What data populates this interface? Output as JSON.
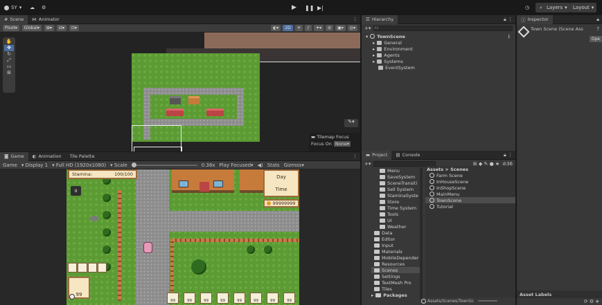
{
  "toolbar": {
    "account": "SY",
    "layers": "Layers",
    "layout": "Layout"
  },
  "scene_panel": {
    "tabs": [
      "Scene",
      "Animator"
    ],
    "pivot": "Pivot",
    "global": "Global",
    "mode_2d": "2D",
    "tilemap_focus": "Tilemap Focus",
    "focus_on_label": "Focus On",
    "focus_on_value": "None"
  },
  "game_panel": {
    "tabs": [
      "Game",
      "Animation",
      "Tile Palette"
    ],
    "display_label": "Game",
    "display": "Display 1",
    "resolution": "Full HD (1920x1080)",
    "scale_label": "Scale",
    "scale_value": "0.38x",
    "play_focused": "Play Focused",
    "stats": "Stats",
    "gizmos": "Gizmos",
    "hud": {
      "stamina_label": "Stamina:",
      "stamina_value": "100/100",
      "day": "Day",
      "time": "Time",
      "money": "99999999",
      "pause": "II",
      "slots": [
        "99",
        "99",
        "99",
        "99",
        "99",
        "99",
        "99",
        "99"
      ],
      "selected_slot_count": "99"
    }
  },
  "hierarchy": {
    "title": "Hierarchy",
    "search_placeholder": "All",
    "root": "TownScene",
    "items": [
      "General",
      "Environment",
      "Agents",
      "Systems",
      "EventSystem"
    ]
  },
  "inspector": {
    "title": "Inspector",
    "object": "Town Scene (Scene Ass",
    "open_button": "Ope",
    "asset_labels": "Asset Labels"
  },
  "project": {
    "tabs": [
      "Project",
      "Console"
    ],
    "count": "36",
    "breadcrumb": "Assets > Scenes",
    "folders": [
      "Menu",
      "SaveSystem",
      "SceneTransiti",
      "Sell System",
      "StaminaSyste",
      "Store",
      "Time System",
      "Tools",
      "UI",
      "Weather",
      "Data",
      "Editor",
      "Input",
      "Materials",
      "MobileDepender",
      "Resources",
      "Scenes",
      "Settings",
      "TextMesh Pro",
      "Tiles"
    ],
    "packages": "Packages",
    "scenes": [
      "Farm Scene",
      "InHouseScene",
      "InShopScene",
      "MainMenu",
      "TownScene",
      "Tutorial"
    ],
    "selected_scene": "TownScene",
    "path": "Assets/Scenes/TownSc"
  }
}
